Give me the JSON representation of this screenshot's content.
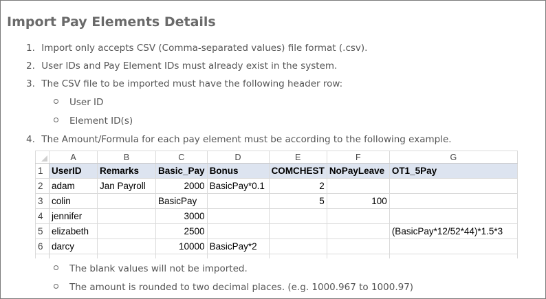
{
  "title": "Import Pay Elements Details",
  "list": [
    {
      "num": "1.",
      "text": "Import only accepts CSV (Comma-separated values) file format (.csv)."
    },
    {
      "num": "2.",
      "text": "User IDs and Pay Element IDs must already exist in the system."
    },
    {
      "num": "3.",
      "text": "The CSV file to be imported must have the following header row:"
    },
    {
      "num": "4.",
      "text": "The Amount/Formula for each pay element must be according to the following example."
    }
  ],
  "header_fields": [
    "User ID",
    "Element ID(s)"
  ],
  "spreadsheet": {
    "columns": [
      "A",
      "B",
      "C",
      "D",
      "E",
      "F",
      "G"
    ],
    "row_numbers": [
      "1",
      "2",
      "3",
      "4",
      "5",
      "6"
    ],
    "rows": [
      [
        "UserID",
        "Remarks",
        "Basic_Pay",
        "Bonus",
        "COMCHEST",
        "NoPayLeave",
        "OT1_5Pay"
      ],
      [
        "adam",
        "Jan Payroll",
        "2000",
        "BasicPay*0.1",
        "2",
        "",
        ""
      ],
      [
        "colin",
        "",
        "BasicPay",
        "",
        "5",
        "100",
        ""
      ],
      [
        "jennifer",
        "",
        "3000",
        "",
        "",
        "",
        ""
      ],
      [
        "elizabeth",
        "",
        "2500",
        "",
        "",
        "",
        "(BasicPay*12/52*44)*1.5*3"
      ],
      [
        "darcy",
        "",
        "10000",
        "BasicPay*2",
        "",
        "",
        ""
      ]
    ]
  },
  "notes": [
    "The blank values will not be imported.",
    "The amount is rounded to two decimal places. (e.g. 1000.967 to 1000.97)"
  ]
}
